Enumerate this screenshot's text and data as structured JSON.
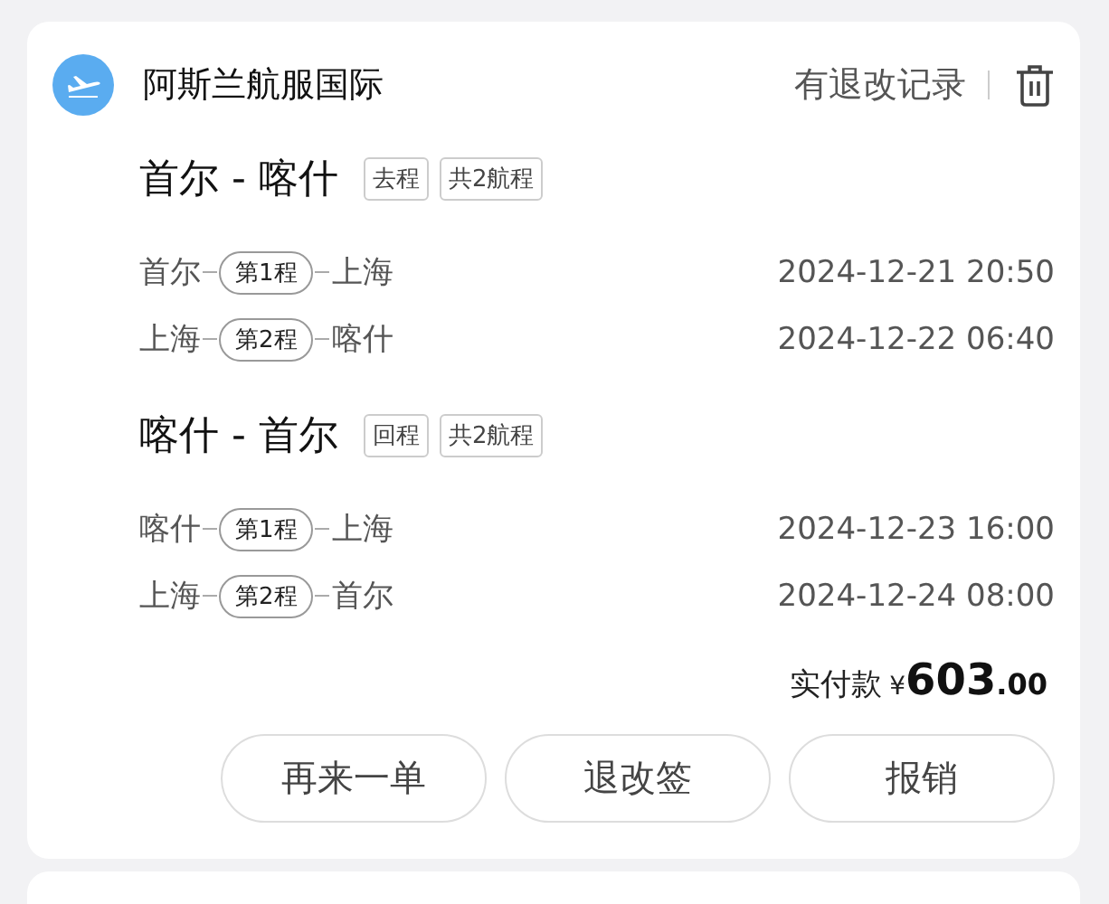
{
  "order": {
    "airline": "阿斯兰航服国际",
    "record_link": "有退改记录",
    "trips": [
      {
        "title": "首尔 - 喀什",
        "tags": [
          "去程",
          "共2航程"
        ],
        "segments": [
          {
            "from": "首尔",
            "leg": "第1程",
            "to": "上海",
            "time": "2024-12-21 20:50"
          },
          {
            "from": "上海",
            "leg": "第2程",
            "to": "喀什",
            "time": "2024-12-22 06:40"
          }
        ]
      },
      {
        "title": "喀什 - 首尔",
        "tags": [
          "回程",
          "共2航程"
        ],
        "segments": [
          {
            "from": "喀什",
            "leg": "第1程",
            "to": "上海",
            "time": "2024-12-23 16:00"
          },
          {
            "from": "上海",
            "leg": "第2程",
            "to": "首尔",
            "time": "2024-12-24 08:00"
          }
        ]
      }
    ],
    "price": {
      "label": "实付款",
      "currency": "¥",
      "integer": "603",
      "decimal": ".00"
    },
    "buttons": [
      "再来一单",
      "退改签",
      "报销"
    ]
  }
}
